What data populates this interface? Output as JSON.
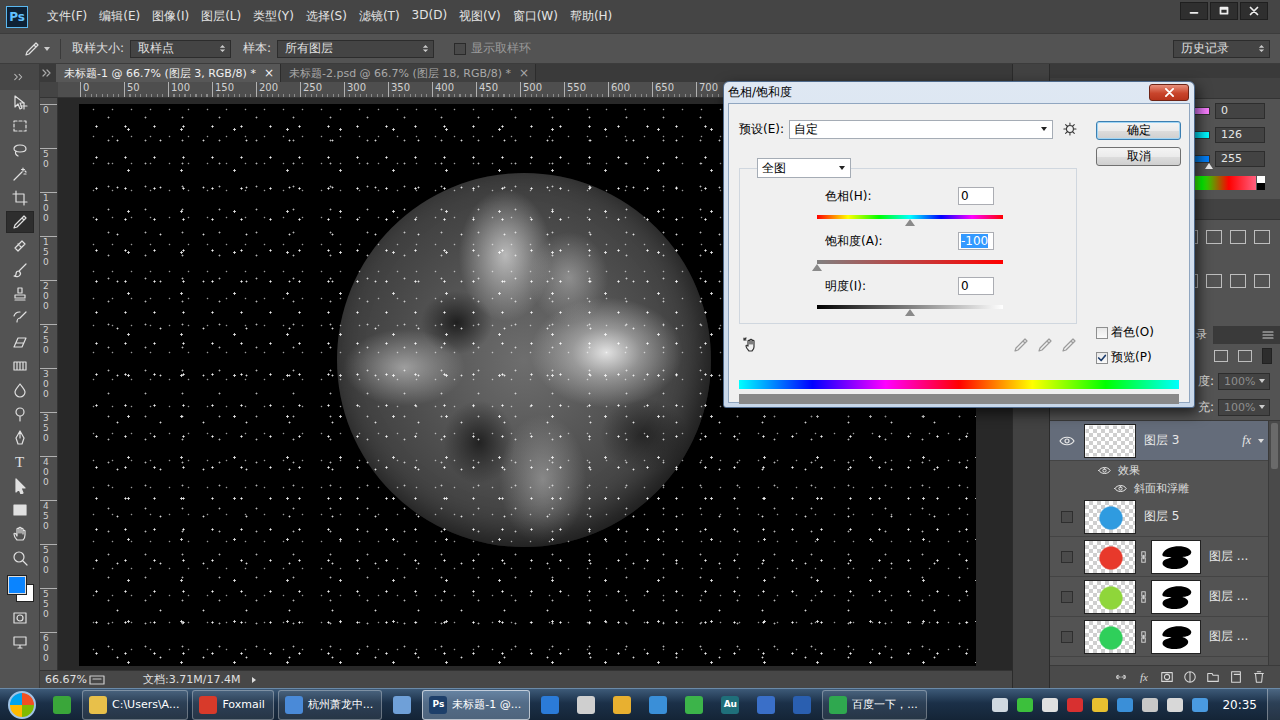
{
  "app": {
    "logo": "Ps"
  },
  "menu": [
    "文件(F)",
    "编辑(E)",
    "图像(I)",
    "图层(L)",
    "类型(Y)",
    "选择(S)",
    "滤镜(T)",
    "3D(D)",
    "视图(V)",
    "窗口(W)",
    "帮助(H)"
  ],
  "options_bar": {
    "sample_size_label": "取样大小:",
    "sample_size": "取样点",
    "sample_label": "样本:",
    "sample": "所有图层",
    "sample_ring": {
      "label": "显示取样环",
      "checked": false
    },
    "workspace": "历史记录"
  },
  "tools": [
    {
      "kind": "move",
      "selected": false
    },
    {
      "kind": "marquee",
      "selected": false
    },
    {
      "kind": "lasso",
      "selected": false
    },
    {
      "kind": "wand",
      "selected": false
    },
    {
      "kind": "crop",
      "selected": false
    },
    {
      "kind": "eyedropper",
      "selected": true
    },
    {
      "kind": "healing",
      "selected": false
    },
    {
      "kind": "brush",
      "selected": false
    },
    {
      "kind": "stamp",
      "selected": false
    },
    {
      "kind": "history",
      "selected": false
    },
    {
      "kind": "eraser",
      "selected": false
    },
    {
      "kind": "gradient",
      "selected": false
    },
    {
      "kind": "blur",
      "selected": false
    },
    {
      "kind": "dodge",
      "selected": false
    },
    {
      "kind": "pen",
      "selected": false
    },
    {
      "kind": "type",
      "selected": false,
      "text": "T"
    },
    {
      "kind": "path-select",
      "selected": false
    },
    {
      "kind": "shape",
      "selected": false
    },
    {
      "kind": "hand",
      "selected": false
    },
    {
      "kind": "zoom",
      "selected": false
    }
  ],
  "mode_tools": [
    {
      "kind": "quickmask",
      "selected": false
    },
    {
      "kind": "screen",
      "selected": false
    }
  ],
  "doc_tabs": [
    {
      "label": "未标题-1 @ 66.7% (图层 3, RGB/8) *",
      "selected": true,
      "close": "×"
    },
    {
      "label": "未标题-2.psd @ 66.7% (图层 18, RGB/8) *",
      "selected": false,
      "close": "×"
    }
  ],
  "rulers": {
    "horizontal": [
      "0",
      "50",
      "100",
      "150",
      "200",
      "250",
      "300",
      "350",
      "400",
      "450",
      "500",
      "550",
      "600",
      "650",
      "700"
    ],
    "vertical": [
      "0",
      "50",
      "100",
      "150",
      "200",
      "250",
      "300",
      "350",
      "400",
      "450",
      "500",
      "550",
      "600"
    ]
  },
  "status_bar": {
    "zoom": "66.67%",
    "doc_size": "文档:3.71M/17.4M"
  },
  "dialog": {
    "title": "色相/饱和度",
    "preset_label": "预设(E):",
    "preset": "自定",
    "ok": "确定",
    "cancel": "取消",
    "channel": "全图",
    "sliders": [
      {
        "kind": "hue",
        "label": "色相(H):",
        "value": "0",
        "level": 0.5,
        "selected": false
      },
      {
        "kind": "saturation",
        "label": "饱和度(A):",
        "value": "-100",
        "level": 0,
        "selected": true
      },
      {
        "kind": "lightness",
        "label": "明度(I):",
        "value": "0",
        "level": 0.5,
        "selected": false
      }
    ],
    "checkboxes": [
      {
        "label": "着色(O)",
        "checked": false
      },
      {
        "label": "预览(P)",
        "checked": true
      }
    ]
  },
  "color_panel": {
    "values": [
      {
        "value": "0",
        "level": 0
      },
      {
        "value": "126",
        "level": 0.494
      },
      {
        "value": "255",
        "level": 1
      }
    ]
  },
  "layers_panel": {
    "tab": "录",
    "opacity_label": "度:",
    "opacity": "100%",
    "fill_label": "充:",
    "fill": "100%",
    "layers": [
      {
        "name": "图层 3",
        "visible": true,
        "selected": true,
        "kind": "checker",
        "color": "#ffffff",
        "mask": false,
        "fx": "fx",
        "effects": {
          "label": "效果",
          "visible": true,
          "items": [
            {
              "name": "斜面和浮雕",
              "visible": true
            }
          ]
        }
      },
      {
        "name": "图层 5",
        "visible": false,
        "selected": false,
        "kind": "blob",
        "color": "#2f9be0",
        "mask": false
      },
      {
        "name": "图层 ...",
        "visible": false,
        "selected": false,
        "kind": "blob",
        "color": "#e8392b",
        "mask": true
      },
      {
        "name": "图层 ...",
        "visible": false,
        "selected": false,
        "kind": "blob",
        "color": "#8fd63a",
        "mask": true
      },
      {
        "name": "图层 ...",
        "visible": false,
        "selected": false,
        "kind": "blob",
        "color": "#2fcf5a",
        "mask": true
      }
    ],
    "footer_tools": [
      {
        "kind": "link"
      },
      {
        "kind": "fx",
        "text": "fx"
      },
      {
        "kind": "mask"
      },
      {
        "kind": "adjust"
      },
      {
        "kind": "folder"
      },
      {
        "kind": "new"
      },
      {
        "kind": "trash"
      }
    ]
  },
  "taskbar": {
    "items": [
      {
        "kind": "icon",
        "color": "#3aa63a",
        "selected": false
      },
      {
        "kind": "app",
        "label": "C:\\Users\\A...",
        "color": "#e8c04a",
        "selected": false
      },
      {
        "kind": "app",
        "label": "Foxmail",
        "color": "#d83a2a",
        "selected": false
      },
      {
        "kind": "app",
        "label": "杭州萧龙中...",
        "color": "#4a8ad8",
        "selected": false
      },
      {
        "kind": "icon",
        "color": "#6fa0d8",
        "selected": false
      },
      {
        "kind": "app",
        "label": "未标题-1 @...",
        "color": "#1d3f6a",
        "selected": true,
        "text": "Ps"
      },
      {
        "kind": "icon",
        "color": "#2b7bd8",
        "selected": false
      },
      {
        "kind": "icon",
        "color": "#cfcfcf",
        "selected": false
      },
      {
        "kind": "icon",
        "color": "#e8b030",
        "selected": false
      },
      {
        "kind": "icon",
        "color": "#3a8fd8",
        "selected": false
      },
      {
        "kind": "icon",
        "color": "#3cb44a",
        "selected": false
      },
      {
        "kind": "icon",
        "color": "#1f6f7a",
        "selected": false,
        "text": "Au"
      },
      {
        "kind": "icon",
        "color": "#3a6fc8",
        "selected": false
      },
      {
        "kind": "icon",
        "color": "#2a5fb0",
        "selected": false
      },
      {
        "kind": "app",
        "label": "百度一下，...",
        "color": "#2fa84f",
        "selected": false
      }
    ],
    "tray": [
      {
        "color": "#cfd8e0"
      },
      {
        "color": "#3cc03c"
      },
      {
        "color": "#e0e0e0"
      },
      {
        "color": "#d83030"
      },
      {
        "color": "#e8c030"
      },
      {
        "color": "#3a8fd8"
      },
      {
        "color": "#c8c8c8"
      },
      {
        "color": "#d8d8d8"
      },
      {
        "color": "#4a9ae0"
      }
    ],
    "clock": "20:35"
  }
}
